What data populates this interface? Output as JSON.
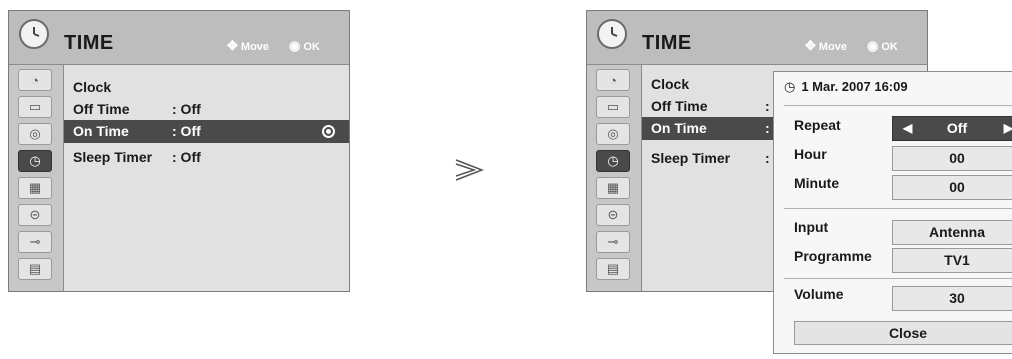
{
  "left_menu": {
    "title": "TIME",
    "move_hint": "Move",
    "ok_hint": "OK",
    "sidebar_icons": [
      "satellite-icon",
      "monitor-icon",
      "speaker-icon",
      "clock-icon",
      "picture-frame-icon",
      "lock-icon",
      "plug-icon",
      "clapperboard-icon"
    ],
    "active_sidebar": 3,
    "rows": [
      {
        "label": "Clock",
        "value": ""
      },
      {
        "label": "Off Time",
        "value": ": Off"
      },
      {
        "label": "On Time",
        "value": ": Off",
        "selected": true
      },
      {
        "label": "Sleep Timer",
        "value": ": Off"
      }
    ]
  },
  "separator_symbol": "≫",
  "right_menu": {
    "title": "TIME",
    "move_hint": "Move",
    "ok_hint": "OK",
    "rows": [
      {
        "label": "Clock",
        "value": ""
      },
      {
        "label": "Off Time",
        "value": ":"
      },
      {
        "label": "On Time",
        "value": ":",
        "selected": true
      },
      {
        "label": "Sleep Timer",
        "value": ":"
      }
    ]
  },
  "popup": {
    "datetime": "1 Mar. 2007 16:09",
    "fields": [
      {
        "label": "Repeat",
        "value": "Off",
        "active": true
      },
      {
        "label": "Hour",
        "value": "00"
      },
      {
        "label": "Minute",
        "value": "00"
      },
      {
        "label": "Input",
        "value": "Antenna"
      },
      {
        "label": "Programme",
        "value": "TV1"
      },
      {
        "label": "Volume",
        "value": "30"
      }
    ],
    "close_label": "Close"
  },
  "colors": {
    "accent": "#4a4a4a",
    "header": "#bdbdbd",
    "panel": "#e1e1e1"
  }
}
